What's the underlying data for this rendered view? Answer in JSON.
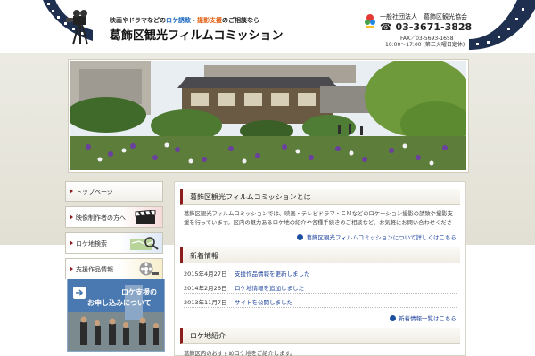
{
  "header": {
    "tagline_prefix": "映画やドラマなどの",
    "tagline_a": "ロケ誘致",
    "tagline_mid": "・",
    "tagline_b": "撮影支援",
    "tagline_suffix": "のご相談なら",
    "site_title": "葛飾区観光フィルムコミッション",
    "org_name": "一般社団法人　葛飾区観光協会",
    "phone": "☎ 03-3671-3828",
    "fax": "FAX／03-5693-1658",
    "hours": "10:00〜17:00 (第三火曜日定休)"
  },
  "sidebar": {
    "items": [
      {
        "label": "トップページ",
        "icon": "none"
      },
      {
        "label": "映像制作者の方へ",
        "icon": "clapperboard-icon"
      },
      {
        "label": "ロケ地検索",
        "icon": "magnifier-map-icon"
      },
      {
        "label": "支援作品情報",
        "icon": "film-reel-icon"
      }
    ],
    "banner_line1": "ロケ支援の",
    "banner_line2": "お申し込みについて"
  },
  "main": {
    "section1_title": "葛飾区観光フィルムコミッションとは",
    "intro_text": "葛飾区観光フィルムコミッションでは、映画・テレビドラマ・ＣＭなどのロケーション撮影の誘致や撮影支援を行っています。区内の魅力あるロケ地の紹介や各種手続きのご相談など、お気軽にお問い合わせください。",
    "more_link": "葛飾区観光フィルムコミッションについて詳しくはこちら",
    "news_title": "新着情報",
    "news": [
      {
        "date": "2015年4月27日",
        "title": "支援作品情報を更新しました"
      },
      {
        "date": "2014年2月26日",
        "title": "ロケ地情報を追加しました"
      },
      {
        "date": "2013年11月7日",
        "title": "サイトを公開しました"
      }
    ],
    "news_more": "新着情報一覧はこちら",
    "section3_title": "ロケ地紹介",
    "section3_text": "葛飾区内のおすすめロケ地をご紹介します。"
  },
  "colors": {
    "accent": "#8c1d1d",
    "link": "#1a3f9c",
    "band": "#e7e5db"
  }
}
